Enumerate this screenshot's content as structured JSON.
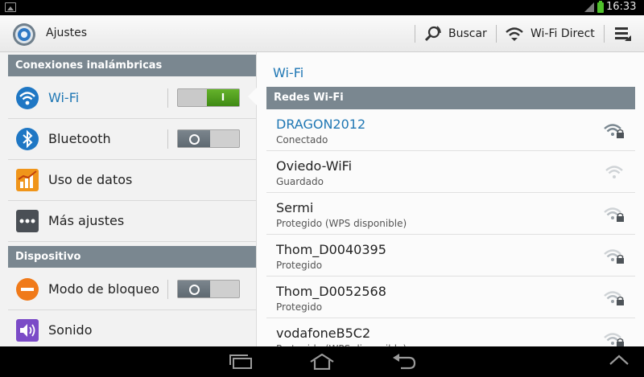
{
  "status_bar": {
    "time": "16:33"
  },
  "action_bar": {
    "title": "Ajustes",
    "search_label": "Buscar",
    "wifi_direct_label": "Wi-Fi Direct"
  },
  "sidebar": {
    "section_wireless": "Conexiones inalámbricas",
    "section_device": "Dispositivo",
    "items": [
      {
        "label": "Wi-Fi",
        "toggle": "on",
        "toggle_on_text": "I"
      },
      {
        "label": "Bluetooth",
        "toggle": "off"
      },
      {
        "label": "Uso de datos"
      },
      {
        "label": "Más ajustes"
      },
      {
        "label": "Modo de bloqueo",
        "toggle": "off"
      },
      {
        "label": "Sonido"
      }
    ]
  },
  "wifi_panel": {
    "title": "Wi-Fi",
    "section": "Redes Wi-Fi",
    "networks": [
      {
        "name": "DRAGON2012",
        "status": "Conectado",
        "locked": true
      },
      {
        "name": "Oviedo-WiFi",
        "status": "Guardado",
        "locked": false
      },
      {
        "name": "Sermi",
        "status": "Protegido (WPS disponible)",
        "locked": true
      },
      {
        "name": "Thom_D0040395",
        "status": "Protegido",
        "locked": true
      },
      {
        "name": "Thom_D0052568",
        "status": "Protegido",
        "locked": true
      },
      {
        "name": "vodafoneB5C2",
        "status": "Protegido (WPS disponible)",
        "locked": true
      }
    ]
  },
  "colors": {
    "accent": "#1f77b4",
    "section_header": "#7a8790",
    "toggle_on": "#4f9e1f"
  }
}
